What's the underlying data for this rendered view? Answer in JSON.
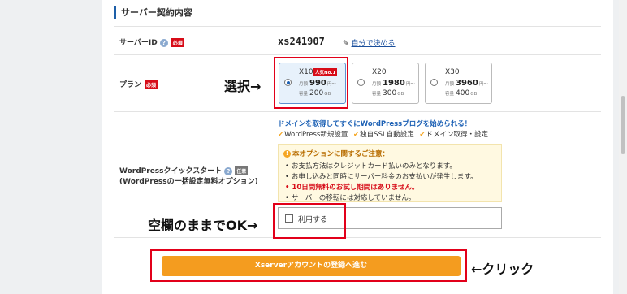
{
  "section": {
    "title": "サーバー契約内容"
  },
  "server_id": {
    "label": "サーバーID",
    "help": "?",
    "required": "必須",
    "value": "xs241907",
    "link_label": "自分で決める"
  },
  "plan": {
    "label": "プラン",
    "required": "必須",
    "monthly_label": "月額",
    "monthly_suffix": "円〜",
    "capacity_label": "容量",
    "capacity_unit": "GB",
    "options": [
      {
        "name": "X10",
        "badge": "人気No.1",
        "price": "990",
        "capacity": "200",
        "selected": true
      },
      {
        "name": "X20",
        "badge": "",
        "price": "1980",
        "capacity": "300",
        "selected": false
      },
      {
        "name": "X30",
        "badge": "",
        "price": "3960",
        "capacity": "400",
        "selected": false
      }
    ]
  },
  "wordpress": {
    "label_line1": "WordPressクイックスタート",
    "help": "?",
    "optional": "任意",
    "label_line2": "(WordPressの一括設定無料オプション)",
    "headline": "ドメインを取得してすぐにWordPressブログを始められる！",
    "features": [
      "WordPress新規設置",
      "独自SSL自動設定",
      "ドメイン取得・設定"
    ],
    "notice_title": "本オプションに関するご注意：",
    "notice_items": [
      "お支払方法はクレジットカード払いのみとなります。",
      "お申し込みと同時にサーバー料金のお支払いが発生します。",
      "10日間無料のお試し期間はありません。",
      "サーバーの移転には対応していません。"
    ],
    "use_label": "利用する",
    "use_checked": false
  },
  "cta": {
    "label": "Xserverアカウントの登録へ進む"
  },
  "annotations": {
    "select": "選択→",
    "leave_blank": "空欄のままでOK→",
    "click": "←クリック"
  },
  "colors": {
    "accent": "#f49c1f",
    "highlight": "#e2001a",
    "link": "#1a4f9c"
  }
}
